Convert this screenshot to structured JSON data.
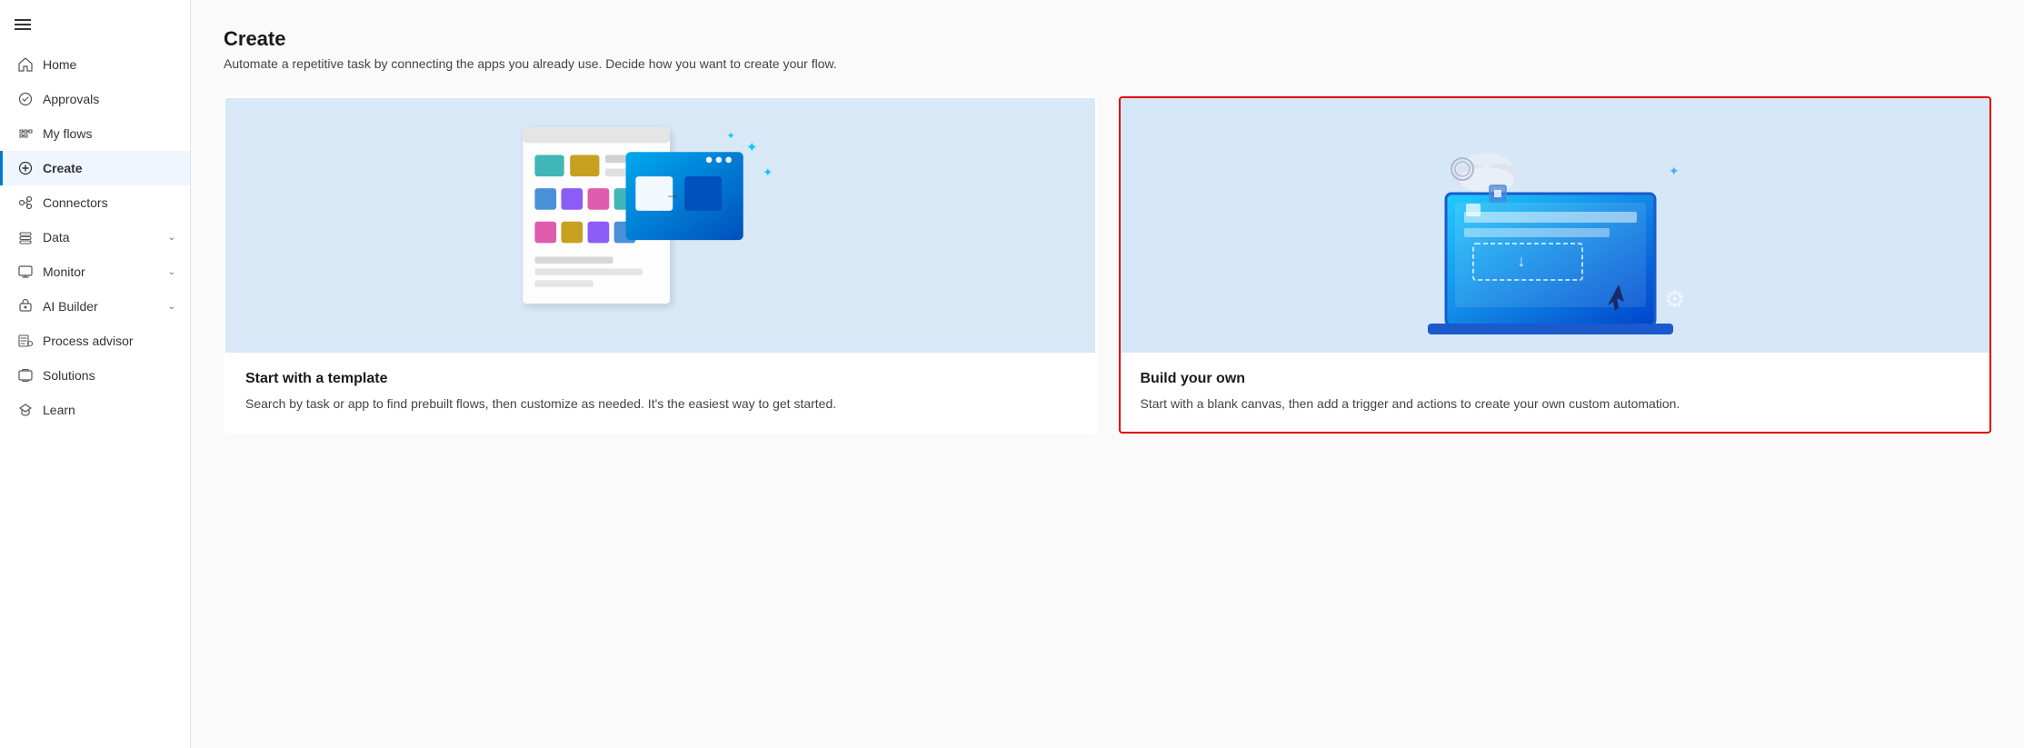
{
  "sidebar": {
    "menu_icon_label": "Menu",
    "items": [
      {
        "id": "home",
        "label": "Home",
        "icon": "home",
        "active": false,
        "hasChevron": false
      },
      {
        "id": "approvals",
        "label": "Approvals",
        "icon": "approvals",
        "active": false,
        "hasChevron": false
      },
      {
        "id": "my-flows",
        "label": "My flows",
        "icon": "flows",
        "active": false,
        "hasChevron": false
      },
      {
        "id": "create",
        "label": "Create",
        "icon": "plus",
        "active": true,
        "hasChevron": false
      },
      {
        "id": "connectors",
        "label": "Connectors",
        "icon": "connectors",
        "active": false,
        "hasChevron": false
      },
      {
        "id": "data",
        "label": "Data",
        "icon": "data",
        "active": false,
        "hasChevron": true
      },
      {
        "id": "monitor",
        "label": "Monitor",
        "icon": "monitor",
        "active": false,
        "hasChevron": true
      },
      {
        "id": "ai-builder",
        "label": "AI Builder",
        "icon": "ai",
        "active": false,
        "hasChevron": true
      },
      {
        "id": "process-advisor",
        "label": "Process advisor",
        "icon": "process",
        "active": false,
        "hasChevron": false
      },
      {
        "id": "solutions",
        "label": "Solutions",
        "icon": "solutions",
        "active": false,
        "hasChevron": false
      },
      {
        "id": "learn",
        "label": "Learn",
        "icon": "learn",
        "active": false,
        "hasChevron": false
      }
    ]
  },
  "main": {
    "title": "Create",
    "subtitle": "Automate a repetitive task by connecting the apps you already use. Decide how you want to create your flow.",
    "cards": [
      {
        "id": "template",
        "title": "Start with a template",
        "description": "Search by task or app to find prebuilt flows, then customize as needed. It's the easiest way to get started.",
        "selected": false
      },
      {
        "id": "build-own",
        "title": "Build your own",
        "description": "Start with a blank canvas, then add a trigger and actions to create your own custom automation.",
        "selected": true
      }
    ]
  }
}
